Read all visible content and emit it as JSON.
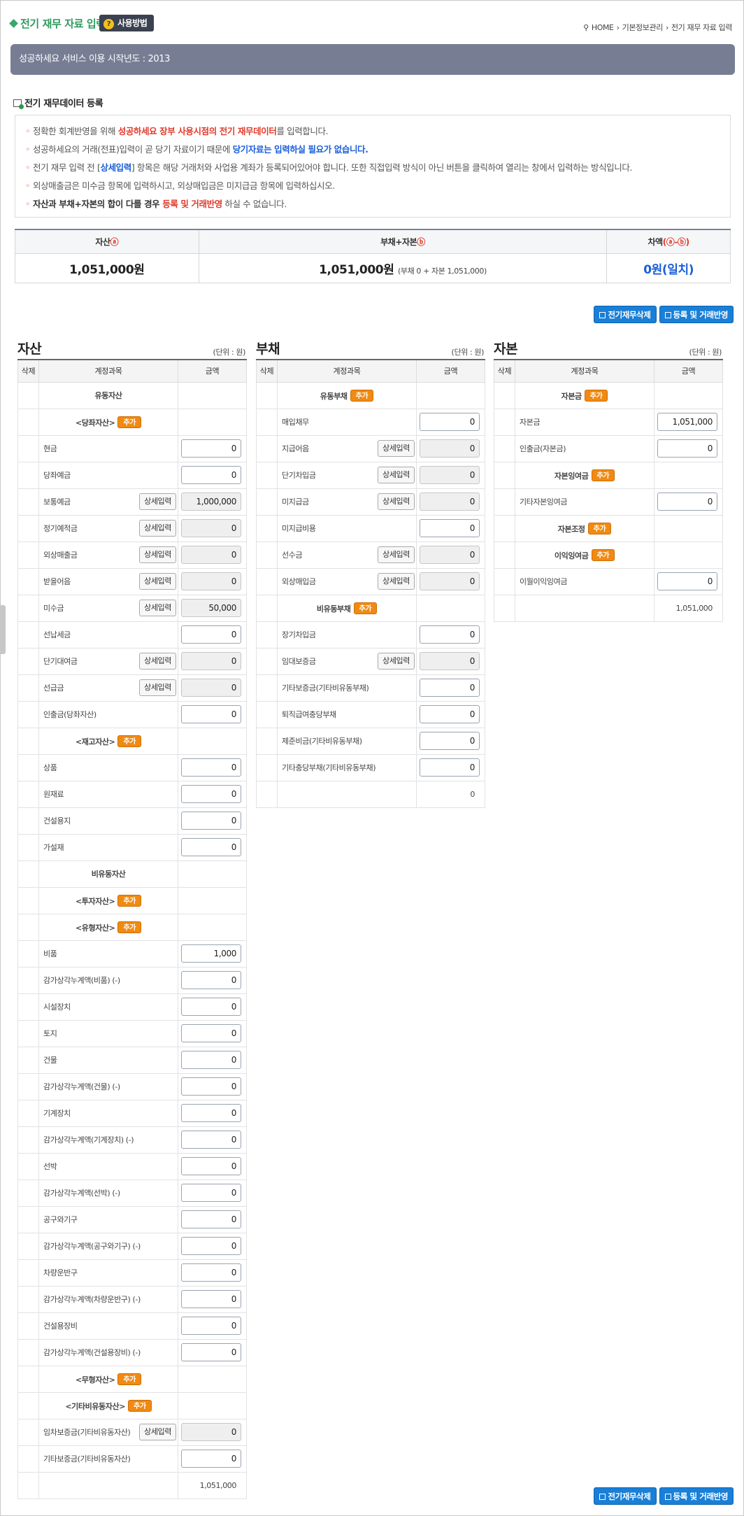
{
  "header": {
    "title": "전기 재무 자료 입력",
    "howto": "사용방법",
    "breadcrumb": [
      "HOME",
      "기본정보관리",
      "전기 재무 자료 입력"
    ]
  },
  "banner": "성공하세요 서비스 이용 시작년도 : 2013",
  "section_title": "전기 재무데이터 등록",
  "notice": {
    "l1a": "정확한 회계반영을 위해 ",
    "l1b": "성공하세요 장부 사용시점의 전기 재무데이터",
    "l1c": "를 입력합니다.",
    "l2a": "성공하세요의 거래(전표)입력이 곧 당기 자료이기 때문에 ",
    "l2b": "당기자료는 입력하실 필요가 없습니다.",
    "l3a": "전기 재무 입력 전 [",
    "l3b": "상세입력",
    "l3c": "] 항목은 해당 거래처와 사업용 계좌가 등록되어있어야 합니다. 또한 직접입력 방식이 아닌 버튼을 클릭하여 열리는 창에서 입력하는 방식입니다.",
    "l4": "외상매출금은 미수금 항목에 입력하시고, 외상매입금은 미지급금 항목에 입력하십시오.",
    "l5a": "자산과 부채+자본의 합이 다를 경우 ",
    "l5b": "등록 및 거래반영",
    "l5c": " 하실 수 없습니다."
  },
  "summary": {
    "h1": "자산",
    "h1c": "ⓐ",
    "h2": "부채+자본",
    "h2c": "ⓑ",
    "h3": "차액",
    "h3c": "(ⓐ-ⓑ)",
    "v1": "1,051,000원",
    "v2": "1,051,000원",
    "v2s": "(부채 0 + 자본 1,051,000)",
    "v3": "0원(일치)"
  },
  "buttons": {
    "delete": "전기재무삭제",
    "apply": "등록 및 거래반영"
  },
  "labels": {
    "th_del": "삭제",
    "th_acct": "계정과목",
    "th_amt": "금액",
    "unit": "(단위 : 원)",
    "add": "추가",
    "detail": "상세입력"
  },
  "assets": {
    "title": "자산",
    "total": "1,051,000",
    "rows": [
      {
        "t": "g",
        "label": "유동자산"
      },
      {
        "t": "s",
        "label": "<당좌자산>",
        "add": true
      },
      {
        "t": "a",
        "label": "현금",
        "value": "0"
      },
      {
        "t": "a",
        "label": "당좌예금",
        "value": "0"
      },
      {
        "t": "d",
        "label": "보통예금",
        "value": "1,000,000"
      },
      {
        "t": "d",
        "label": "정기예적금",
        "value": "0"
      },
      {
        "t": "d",
        "label": "외상매출금",
        "value": "0"
      },
      {
        "t": "d",
        "label": "받을어음",
        "value": "0"
      },
      {
        "t": "d",
        "label": "미수금",
        "value": "50,000"
      },
      {
        "t": "a",
        "label": "선납세금",
        "value": "0"
      },
      {
        "t": "d",
        "label": "단기대여금",
        "value": "0"
      },
      {
        "t": "d",
        "label": "선급금",
        "value": "0"
      },
      {
        "t": "a",
        "label": "인출금(당좌자산)",
        "value": "0"
      },
      {
        "t": "s",
        "label": "<재고자산>",
        "add": true
      },
      {
        "t": "a",
        "label": "상품",
        "value": "0"
      },
      {
        "t": "a",
        "label": "원재료",
        "value": "0"
      },
      {
        "t": "a",
        "label": "건설용지",
        "value": "0"
      },
      {
        "t": "a",
        "label": "가설재",
        "value": "0"
      },
      {
        "t": "g",
        "label": "비유동자산"
      },
      {
        "t": "s",
        "label": "<투자자산>",
        "add": true
      },
      {
        "t": "s",
        "label": "<유형자산>",
        "add": true
      },
      {
        "t": "a",
        "label": "비품",
        "value": "1,000"
      },
      {
        "t": "a",
        "label": "감가상각누계액(비품) (-)",
        "value": "0"
      },
      {
        "t": "a",
        "label": "시설장치",
        "value": "0"
      },
      {
        "t": "a",
        "label": "토지",
        "value": "0"
      },
      {
        "t": "a",
        "label": "건물",
        "value": "0"
      },
      {
        "t": "a",
        "label": "감가상각누계액(건물) (-)",
        "value": "0"
      },
      {
        "t": "a",
        "label": "기계장치",
        "value": "0"
      },
      {
        "t": "a",
        "label": "감가상각누계액(기계장치) (-)",
        "value": "0"
      },
      {
        "t": "a",
        "label": "선박",
        "value": "0"
      },
      {
        "t": "a",
        "label": "감가상각누계액(선박) (-)",
        "value": "0"
      },
      {
        "t": "a",
        "label": "공구와기구",
        "value": "0"
      },
      {
        "t": "a",
        "label": "감가상각누계액(공구와기구) (-)",
        "value": "0"
      },
      {
        "t": "a",
        "label": "차량운반구",
        "value": "0"
      },
      {
        "t": "a",
        "label": "감가상각누계액(차량운반구) (-)",
        "value": "0"
      },
      {
        "t": "a",
        "label": "건설용장비",
        "value": "0"
      },
      {
        "t": "a",
        "label": "감가상각누계액(건설용장비) (-)",
        "value": "0"
      },
      {
        "t": "s",
        "label": "<무형자산>",
        "add": true
      },
      {
        "t": "s",
        "label": "<기타비유동자산>",
        "add": true
      },
      {
        "t": "d",
        "label": "임차보증금(기타비유동자산)",
        "value": "0"
      },
      {
        "t": "a",
        "label": "기타보증금(기타비유동자산)",
        "value": "0"
      }
    ]
  },
  "liabilities": {
    "title": "부채",
    "total": "0",
    "rows": [
      {
        "t": "g",
        "label": "유동부채",
        "add": true
      },
      {
        "t": "a",
        "label": "매입채무",
        "value": "0"
      },
      {
        "t": "d",
        "label": "지급어음",
        "value": "0"
      },
      {
        "t": "d",
        "label": "단기차입금",
        "value": "0"
      },
      {
        "t": "d",
        "label": "미지급금",
        "value": "0"
      },
      {
        "t": "a",
        "label": "미지급비용",
        "value": "0"
      },
      {
        "t": "d",
        "label": "선수금",
        "value": "0"
      },
      {
        "t": "d",
        "label": "외상매입금",
        "value": "0"
      },
      {
        "t": "g",
        "label": "비유동부채",
        "add": true
      },
      {
        "t": "a",
        "label": "장기차입금",
        "value": "0"
      },
      {
        "t": "d",
        "label": "임대보증금",
        "value": "0"
      },
      {
        "t": "a",
        "label": "기타보증금(기타비유동부채)",
        "value": "0"
      },
      {
        "t": "a",
        "label": "퇴직급여충당부채",
        "value": "0"
      },
      {
        "t": "a",
        "label": "제준비금(기타비유동부채)",
        "value": "0"
      },
      {
        "t": "a",
        "label": "기타충당부채(기타비유동부채)",
        "value": "0"
      }
    ]
  },
  "equity": {
    "title": "자본",
    "total": "1,051,000",
    "rows": [
      {
        "t": "g",
        "label": "자본금",
        "add": true
      },
      {
        "t": "a",
        "label": "자본금",
        "value": "1,051,000"
      },
      {
        "t": "a",
        "label": "인출금(자본금)",
        "value": "0"
      },
      {
        "t": "g",
        "label": "자본잉여금",
        "add": true
      },
      {
        "t": "a",
        "label": "기타자본잉여금",
        "value": "0"
      },
      {
        "t": "g",
        "label": "자본조정",
        "add": true
      },
      {
        "t": "g",
        "label": "이익잉여금",
        "add": true
      },
      {
        "t": "a",
        "label": "이월이익잉여금",
        "value": "0"
      }
    ]
  }
}
